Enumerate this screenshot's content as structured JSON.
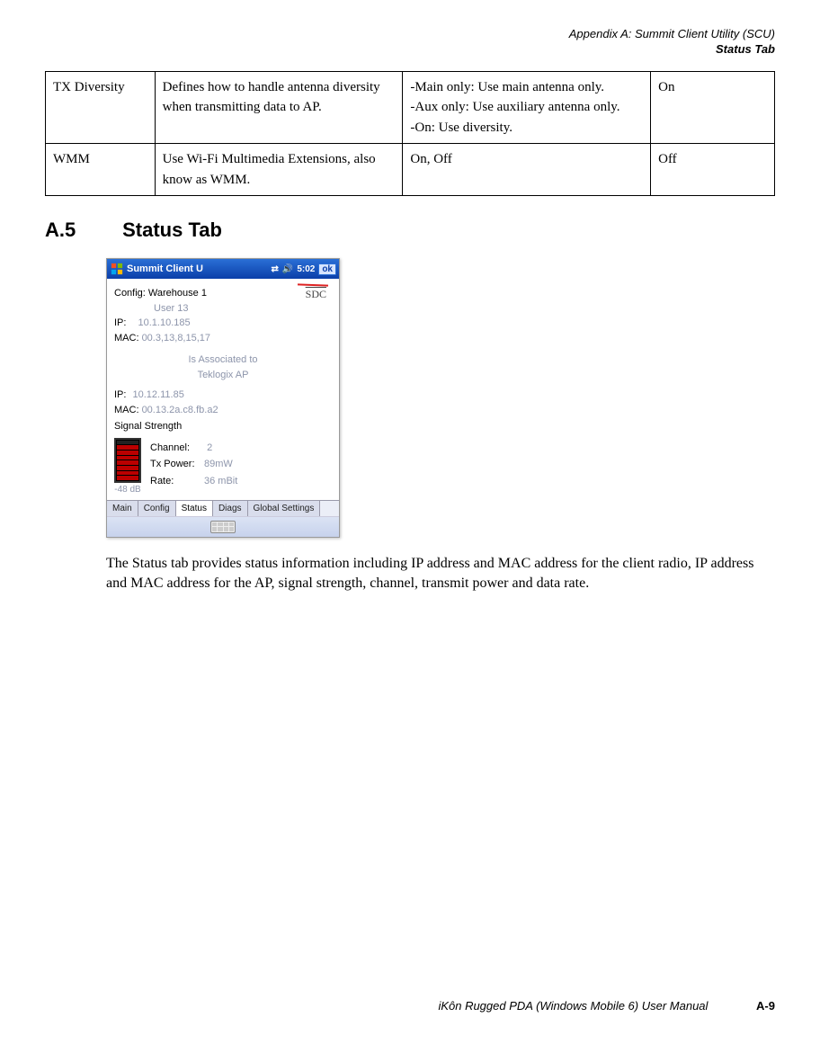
{
  "header": {
    "line1": "Appendix A:  Summit Client Utility (SCU)",
    "line2": "Status Tab"
  },
  "table": {
    "rows": [
      {
        "c1": "TX Diversity",
        "c2": "Defines how to handle antenna diversity when transmitting data to AP.",
        "c3": "-Main only: Use main antenna only.\n-Aux only: Use auxiliary antenna only.\n-On: Use diversity.",
        "c4": "On"
      },
      {
        "c1": "WMM",
        "c2": "Use Wi-Fi Multimedia Extensions, also know as WMM.",
        "c3": "On, Off",
        "c4": "Off"
      }
    ]
  },
  "section": {
    "number": "A.5",
    "title": "Status Tab"
  },
  "screenshot": {
    "titlebar": {
      "title": "Summit Client U",
      "time": "5:02",
      "ok": "ok"
    },
    "logo": "SDC",
    "config": {
      "label": "Config:",
      "value": "Warehouse 1",
      "user": "User 13"
    },
    "client": {
      "ip_label": "IP:",
      "ip": "10.1.10.185",
      "mac_label": "MAC:",
      "mac": "00.3,13,8,15,17"
    },
    "assoc": {
      "line1": "Is Associated to",
      "line2": "Teklogix AP"
    },
    "ap": {
      "ip_label": "IP:",
      "ip": "10.12.11.85",
      "mac_label": "MAC:",
      "mac": "00.13.2a.c8.fb.a2"
    },
    "signal": {
      "heading": "Signal Strength",
      "db": "-48 dB",
      "channel_label": "Channel:",
      "channel": "2",
      "txpower_label": "Tx Power:",
      "txpower": "89mW",
      "rate_label": "Rate:",
      "rate": "36 mBit"
    },
    "tabs": [
      "Main",
      "Config",
      "Status",
      "Diags",
      "Global Settings"
    ]
  },
  "body_paragraph": "The Status tab provides status information including IP address and MAC address for the client radio, IP address and MAC address for the AP, signal strength, channel, transmit power and data rate.",
  "footer": {
    "text": "iKôn Rugged PDA (Windows Mobile 6) User Manual",
    "page": "A-9"
  }
}
